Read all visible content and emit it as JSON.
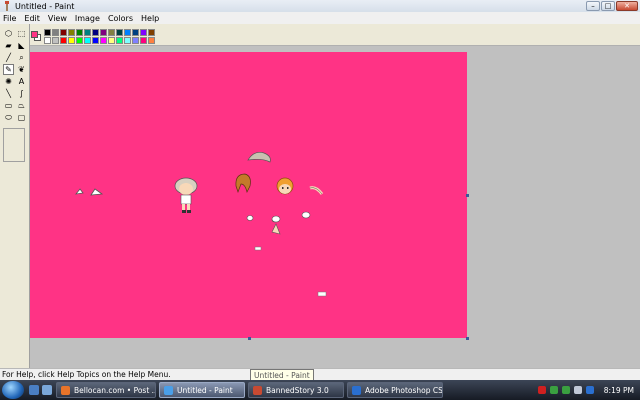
{
  "window": {
    "title": "Untitled - Paint",
    "controls": {
      "minimize": "–",
      "maximize": "□",
      "close": "✕"
    }
  },
  "menu": [
    "File",
    "Edit",
    "View",
    "Image",
    "Colors",
    "Help"
  ],
  "tools": [
    {
      "name": "free-select-icon",
      "glyph": "⬡"
    },
    {
      "name": "rect-select-icon",
      "glyph": "⬚"
    },
    {
      "name": "eraser-icon",
      "glyph": "▰"
    },
    {
      "name": "fill-bucket-icon",
      "glyph": "◣"
    },
    {
      "name": "color-picker-icon",
      "glyph": "╱"
    },
    {
      "name": "magnifier-icon",
      "glyph": "⌕"
    },
    {
      "name": "pencil-icon",
      "glyph": "✎"
    },
    {
      "name": "brush-icon",
      "glyph": "❦"
    },
    {
      "name": "airbrush-icon",
      "glyph": "✺"
    },
    {
      "name": "text-icon",
      "glyph": "A"
    },
    {
      "name": "line-icon",
      "glyph": "╲"
    },
    {
      "name": "curve-icon",
      "glyph": "∫"
    },
    {
      "name": "rectangle-icon",
      "glyph": "▭"
    },
    {
      "name": "polygon-icon",
      "glyph": "⏢"
    },
    {
      "name": "ellipse-icon",
      "glyph": "⬭"
    },
    {
      "name": "rounded-rect-icon",
      "glyph": "▢"
    }
  ],
  "active_tool": "pencil-icon",
  "palette": {
    "foreground": "#ff3385",
    "background": "#ffffff",
    "colors": [
      "#000000",
      "#808080",
      "#800000",
      "#808000",
      "#008000",
      "#008080",
      "#000080",
      "#800080",
      "#808040",
      "#004040",
      "#0080ff",
      "#004080",
      "#8000ff",
      "#804000",
      "#ffffff",
      "#c0c0c0",
      "#ff0000",
      "#ffff00",
      "#00ff00",
      "#00ffff",
      "#0000ff",
      "#ff00ff",
      "#ffff80",
      "#00ff80",
      "#80ffff",
      "#8080ff",
      "#ff0080",
      "#ff8040"
    ]
  },
  "canvas": {
    "background": "#ff3385"
  },
  "status": {
    "help_text": "For Help, click Help Topics on the Help Menu.",
    "tooltip": "Untitled - Paint"
  },
  "taskbar": {
    "quicklaunch": [
      {
        "name": "show-desktop-icon",
        "color": "#4a7fc4"
      },
      {
        "name": "switch-windows-icon",
        "color": "#7aa7d9"
      }
    ],
    "tasks": [
      {
        "name": "task-bellocan",
        "label": "Bellocan.com • Post ...",
        "icon": "firefox-icon",
        "icon_color": "#e8742a",
        "active": false
      },
      {
        "name": "task-paint",
        "label": "Untitled - Paint",
        "icon": "paint-icon",
        "icon_color": "#4a9fe8",
        "active": true
      },
      {
        "name": "task-bannedstory",
        "label": "BannedStory 3.0",
        "icon": "bannedstory-icon",
        "icon_color": "#c84a32",
        "active": false
      },
      {
        "name": "task-photoshop",
        "label": "Adobe Photoshop CS...",
        "icon": "photoshop-icon",
        "icon_color": "#2a6fd0",
        "active": false
      }
    ],
    "tray_icons": [
      {
        "name": "antivirus-icon",
        "color": "#d02020"
      },
      {
        "name": "network-icon",
        "color": "#3aa040"
      },
      {
        "name": "update-icon",
        "color": "#3aa040"
      },
      {
        "name": "volume-icon",
        "color": "#c0c8d8"
      },
      {
        "name": "power-icon",
        "color": "#2a6fd0"
      }
    ],
    "clock": "8:19 PM"
  }
}
